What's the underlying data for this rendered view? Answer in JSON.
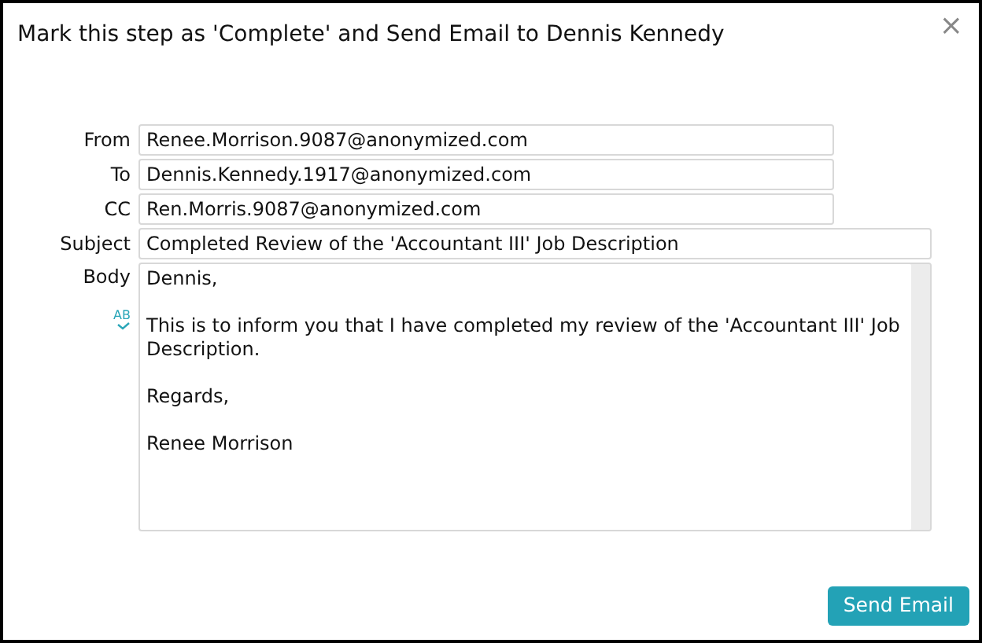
{
  "dialog": {
    "title": "Mark this step as 'Complete' and Send Email to Dennis Kennedy",
    "close": "×"
  },
  "fields": [
    {
      "label": "From",
      "value": "Renee.Morrison.9087@anonymized.com",
      "wide": false
    },
    {
      "label": "To",
      "value": "Dennis.Kennedy.1917@anonymized.com",
      "wide": false
    },
    {
      "label": "CC",
      "value": "Ren.Morris.9087@anonymized.com",
      "wide": false
    },
    {
      "label": "Subject",
      "value": "Completed Review of the 'Accountant III' Job Description",
      "wide": true
    }
  ],
  "body": {
    "label": "Body",
    "spellcheck_icon_text": "AB",
    "value": "Dennis,\n\nThis is to inform you that I have completed my review of the 'Accountant III' Job Description.\n\nRegards,\n\nRenee Morrison"
  },
  "buttons": [
    "Send Email"
  ]
}
